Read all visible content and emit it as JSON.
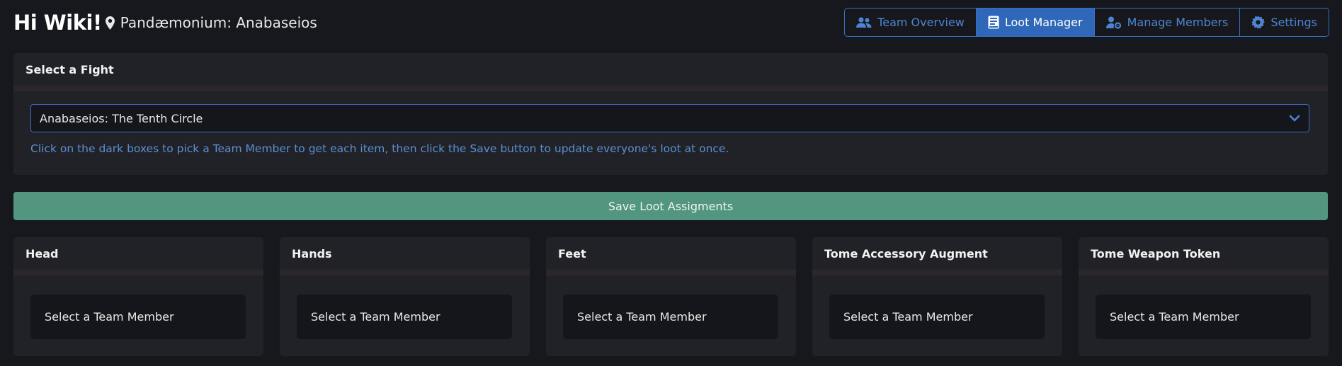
{
  "header": {
    "greeting": "Hi Wiki!",
    "team_name": "Pandæmonium: Anabaseios"
  },
  "nav": {
    "items": [
      {
        "label": "Team Overview",
        "icon": "users-icon",
        "active": false
      },
      {
        "label": "Loot Manager",
        "icon": "book-icon",
        "active": true
      },
      {
        "label": "Manage Members",
        "icon": "user-cog-icon",
        "active": false
      },
      {
        "label": "Settings",
        "icon": "gear-icon",
        "active": false
      }
    ]
  },
  "fight": {
    "title": "Select a Fight",
    "selected": "Anabaseios: The Tenth Circle",
    "hint": "Click on the dark boxes to pick a Team Member to get each item, then click the Save button to update everyone's loot at once."
  },
  "save_label": "Save Loot Assigments",
  "slots": [
    {
      "title": "Head",
      "value": "Select a Team Member"
    },
    {
      "title": "Hands",
      "value": "Select a Team Member"
    },
    {
      "title": "Feet",
      "value": "Select a Team Member"
    },
    {
      "title": "Tome Accessory Augment",
      "value": "Select a Team Member"
    },
    {
      "title": "Tome Weapon Token",
      "value": "Select a Team Member"
    }
  ],
  "colors": {
    "background": "#17181d",
    "card": "#212228",
    "accent": "#3a6fc0",
    "active_nav": "#2f68b8",
    "save": "#529680",
    "hint_text": "#5b8fd0"
  }
}
